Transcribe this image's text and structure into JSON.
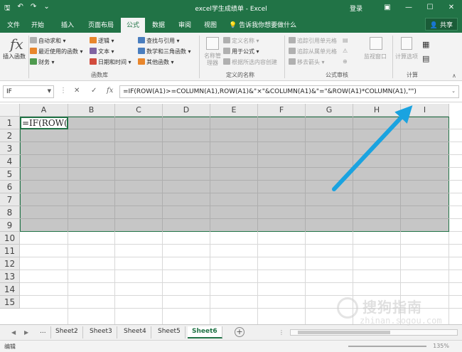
{
  "window": {
    "title": "excel学生成绩单 - Excel",
    "login": "登录",
    "qat": [
      "save-icon",
      "undo-icon",
      "redo-icon",
      "customize-icon"
    ],
    "controls": [
      "restore-ribbon-icon",
      "minimize-icon",
      "maximize-icon",
      "close-icon"
    ]
  },
  "tabs": [
    "文件",
    "开始",
    "插入",
    "页面布局",
    "公式",
    "数据",
    "审阅",
    "视图"
  ],
  "active_tab": "公式",
  "tell_me": "告诉我你想要做什么",
  "share": "共享",
  "ribbon": {
    "insert_function": "插入函数",
    "function_library": {
      "label": "函数库",
      "items": [
        "自动求和",
        "最近使用的函数",
        "财务",
        "逻辑",
        "文本",
        "日期和时间",
        "查找与引用",
        "数学和三角函数",
        "其他函数"
      ]
    },
    "defined_names": {
      "label": "定义的名称",
      "name_manager": "名称管理器",
      "items": [
        "定义名称",
        "用于公式",
        "根据所选内容创建"
      ]
    },
    "formula_auditing": {
      "label": "公式审核",
      "items": [
        "追踪引用单元格",
        "追踪从属单元格",
        "移去箭头"
      ]
    },
    "watch_window": "监视窗口",
    "calculation": {
      "label": "计算",
      "options": "计算选项"
    }
  },
  "formula_bar": {
    "name_box": "IF",
    "cancel": "✕",
    "enter": "✓",
    "fx": "fx",
    "formula": "=IF(ROW(A1)>=COLUMN(A1),ROW(A1)&\"×\"&COLUMN(A1)&\"=\"&ROW(A1)*COLUMN(A1),\"\")"
  },
  "grid": {
    "columns": [
      "A",
      "B",
      "C",
      "D",
      "E",
      "F",
      "G",
      "H",
      "I"
    ],
    "rows": [
      "1",
      "2",
      "3",
      "4",
      "5",
      "6",
      "7",
      "8",
      "9",
      "10",
      "11",
      "12",
      "13",
      "14",
      "15"
    ],
    "active_cell_text": "=IF(ROW(A"
  },
  "sheets": {
    "overflow": "...",
    "tabs": [
      "Sheet2",
      "Sheet3",
      "Sheet4",
      "Sheet5",
      "Sheet6"
    ],
    "active": "Sheet6"
  },
  "status": {
    "mode": "编辑",
    "zoom": "135%"
  },
  "watermark": {
    "text": "搜狗指南",
    "url": "zhinan.sogou.com"
  },
  "colors": {
    "excel_green": "#217346",
    "selection_fill": "#c6c6c6",
    "arrow_blue": "#1aa3e0"
  }
}
